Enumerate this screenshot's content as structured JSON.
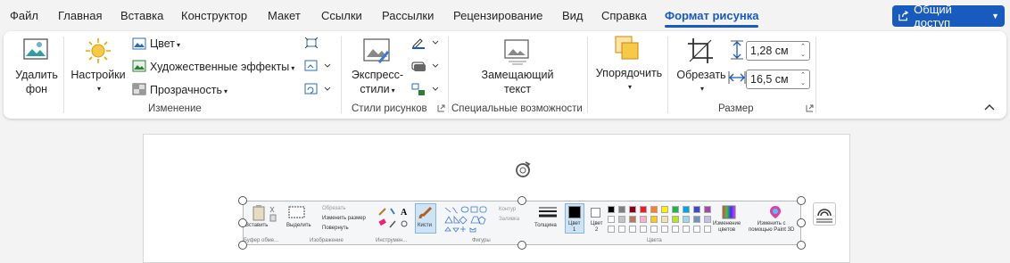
{
  "menu": {
    "tabs": [
      "Файл",
      "Главная",
      "Вставка",
      "Конструктор",
      "Макет",
      "Ссылки",
      "Рассылки",
      "Рецензирование",
      "Вид",
      "Справка",
      "Формат рисунка"
    ],
    "share_label": "Общий доступ"
  },
  "ribbon": {
    "remove_bg": [
      "Удалить",
      "фон"
    ],
    "settings": "Настройки",
    "color": "Цвет",
    "art_effects": "Художественные эффекты",
    "transparency": "Прозрачность",
    "group_change": "Изменение",
    "express": [
      "Экспресс-",
      "стили"
    ],
    "group_styles": "Стили рисунков",
    "alt_text": [
      "Замещающий",
      "текст"
    ],
    "group_access": "Специальные возможности",
    "arrange": "Упорядочить",
    "crop": "Обрезать",
    "height_value": "1,28 см",
    "width_value": "16,5 см",
    "group_size": "Размер"
  },
  "paint": {
    "paste": "Вставить",
    "clipboard": "Буфер обме...",
    "select": "Выделить",
    "crop": "Обрезать",
    "resize": "Изменить размер",
    "rotate": "Повернуть",
    "image": "Изображение",
    "tools": "Инструмен...",
    "brushes": "Кисти",
    "outline": "Контур",
    "fill": "Заливка",
    "shapes": "Фигуры",
    "thickness": "Толщина",
    "color1": [
      "Цвет",
      "1"
    ],
    "color2": [
      "Цвет",
      "2"
    ],
    "edit_colors": [
      "Изменение",
      "цветов"
    ],
    "paint3d": [
      "Изменить с",
      "помощью Paint 3D"
    ],
    "colors": "Цвета",
    "palette": [
      "#000000",
      "#7f7f7f",
      "#880015",
      "#ed1c24",
      "#ff7f27",
      "#fff200",
      "#22b14c",
      "#00a2e8",
      "#3f48cc",
      "#a349a4",
      "#ffffff",
      "#c3c3c3",
      "#b97a57",
      "#ffaec9",
      "#ffc90e",
      "#efe4b0",
      "#b5e61d",
      "#99d9ea",
      "#7092be",
      "#c8bfe7"
    ]
  }
}
